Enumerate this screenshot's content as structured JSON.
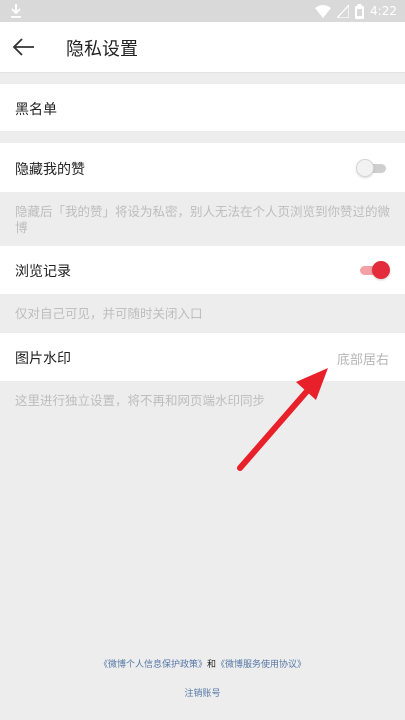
{
  "status_bar": {
    "time": "4:22",
    "icons": [
      "download-icon",
      "wifi-icon",
      "signal-icon",
      "battery-icon"
    ]
  },
  "header": {
    "title": "隐私设置",
    "back_icon": "arrow-left-icon"
  },
  "settings": {
    "blacklist": {
      "label": "黑名单"
    },
    "hide_likes": {
      "label": "隐藏我的赞",
      "enabled": false,
      "note": "隐藏后「我的赞」将设为私密，别人无法在个人页浏览到你赞过的微博"
    },
    "browse_history": {
      "label": "浏览记录",
      "enabled": true,
      "note": "仅对自己可见，并可随时关闭入口"
    },
    "image_watermark": {
      "label": "图片水印",
      "value": "底部居右",
      "note": "这里进行独立设置，将不再和网页端水印同步"
    }
  },
  "footer": {
    "privacy_policy": "《微博个人信息保护政策》",
    "conjunction": "和",
    "service_agreement": "《微博服务使用协议》",
    "cancel_account": "注销账号"
  },
  "colors": {
    "accent": "#e32b3b",
    "annotation_arrow": "#e8202a",
    "link": "#5577a6",
    "background": "#ededed"
  }
}
